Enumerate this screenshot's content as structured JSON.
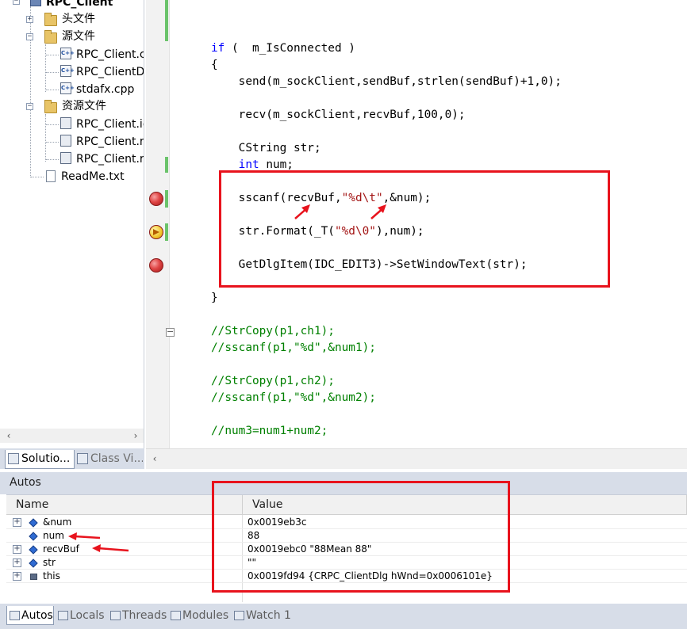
{
  "solution": {
    "project": "RPC_Client",
    "items": [
      {
        "label": "头文件",
        "kind": "folder",
        "expander": "+"
      },
      {
        "label": "源文件",
        "kind": "folder",
        "expander": "−"
      },
      {
        "label": "RPC_Client.cp",
        "kind": "cpp"
      },
      {
        "label": "RPC_ClientDl",
        "kind": "cpp"
      },
      {
        "label": "stdafx.cpp",
        "kind": "cpp"
      },
      {
        "label": "资源文件",
        "kind": "folder",
        "expander": "−"
      },
      {
        "label": "RPC_Client.ic",
        "kind": "res"
      },
      {
        "label": "RPC_Client.rc",
        "kind": "res"
      },
      {
        "label": "RPC_Client.rc",
        "kind": "res"
      },
      {
        "label": "ReadMe.txt",
        "kind": "txt"
      }
    ],
    "tabs": [
      "Solutio...",
      "Class Vi..."
    ]
  },
  "code": {
    "lines": [
      {
        "parts": [
          [
            "kw",
            "if"
          ],
          [
            "txt",
            " (  m_IsConnected )"
          ]
        ]
      },
      {
        "parts": [
          [
            "txt",
            "{"
          ]
        ]
      },
      {
        "parts": [
          [
            "txt",
            "    send(m_sockClient,sendBuf,strlen(sendBuf)+1,0);"
          ]
        ]
      },
      {
        "parts": [
          [
            "txt",
            "    recv(m_sockClient,recvBuf,100,0);"
          ]
        ]
      },
      {
        "parts": [
          [
            "txt",
            "    CString str;"
          ]
        ]
      },
      {
        "parts": [
          [
            "kw",
            "    int"
          ],
          [
            "txt",
            " num;"
          ]
        ]
      },
      {
        "parts": [
          [
            "txt",
            "    sscanf(recvBuf,"
          ],
          [
            "str",
            "\"%d\\t\""
          ],
          [
            "txt",
            ",&num);"
          ]
        ]
      },
      {
        "parts": [
          [
            "txt",
            "    str.Format(_T("
          ],
          [
            "str",
            "\"%d\\0\""
          ],
          [
            "txt",
            "),num);"
          ]
        ]
      },
      {
        "parts": [
          [
            "txt",
            "    GetDlgItem(IDC_EDIT3)->SetWindowText(str);"
          ]
        ]
      },
      {
        "parts": [
          [
            "txt",
            "}"
          ]
        ]
      },
      {
        "parts": [
          [
            "cmt",
            "//StrCopy(p1,ch1);"
          ]
        ]
      },
      {
        "parts": [
          [
            "cmt",
            "//sscanf(p1,\"%d\",&num1);"
          ]
        ]
      },
      {
        "parts": [
          [
            "cmt",
            "//StrCopy(p1,ch2);"
          ]
        ]
      },
      {
        "parts": [
          [
            "cmt",
            "//sscanf(p1,\"%d\",&num2);"
          ]
        ]
      },
      {
        "parts": [
          [
            "cmt",
            "//num3=num1+num2;"
          ]
        ]
      }
    ]
  },
  "autos": {
    "title": "Autos",
    "columns": {
      "name": "Name",
      "value": "Value"
    },
    "rows": [
      {
        "name": "&num",
        "value": "0x0019eb3c",
        "expandable": true,
        "icon": "field"
      },
      {
        "name": "num",
        "value": "88",
        "expandable": false,
        "icon": "field"
      },
      {
        "name": "recvBuf",
        "value": "0x0019ebc0 \"88Mean 88\"",
        "expandable": true,
        "icon": "field"
      },
      {
        "name": "str",
        "value": "\"\"",
        "expandable": true,
        "icon": "field"
      },
      {
        "name": "this",
        "value": "0x0019fd94 {CRPC_ClientDlg hWnd=0x0006101e}",
        "expandable": true,
        "icon": "object"
      }
    ]
  },
  "bottom_tabs": [
    "Autos",
    "Locals",
    "Threads",
    "Modules",
    "Watch 1"
  ],
  "colors": {
    "annotation": "#e8131d",
    "keyword": "#0000ff",
    "string": "#a31515",
    "comment": "#008000",
    "breakpoint": "#e04646"
  }
}
